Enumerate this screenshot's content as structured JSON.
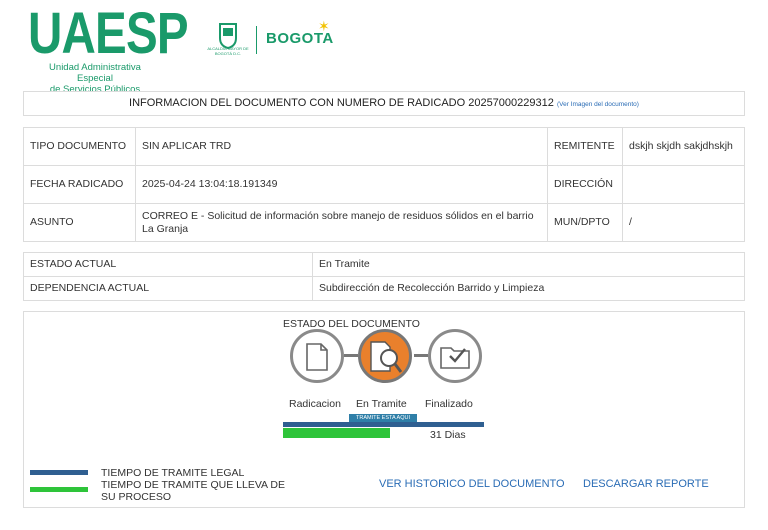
{
  "header": {
    "logo": "UAESP",
    "logo_sub_1": "Unidad Administrativa Especial",
    "logo_sub_2": "de Servicios Públicos",
    "alcaldia_text": "ALCALDÍA MAYOR DE BOGOTÁ D.C.",
    "bogota": "BOGOTA"
  },
  "title": {
    "text": "INFORMACION DEL DOCUMENTO CON NUMERO DE RADICADO 20257000229312",
    "link": "(Ver Imagen del documento)"
  },
  "info": {
    "tipo_label": "TIPO DOCUMENTO",
    "tipo_value": "SIN APLICAR TRD",
    "remitente_label": "REMITENTE",
    "remitente_value": "dskjh skjdh sakjdhskjh",
    "fecha_label": "FECHA RADICADO",
    "fecha_value": "2025-04-24 13:04:18.191349",
    "direccion_label": "DIRECCIÓN",
    "direccion_value": "",
    "asunto_label": "ASUNTO",
    "asunto_value": "CORREO E - Solicitud de información sobre manejo de residuos sólidos en el barrio La Granja",
    "mun_label": "MUN/DPTO",
    "mun_value": "/"
  },
  "estado": {
    "estado_label": "ESTADO ACTUAL",
    "estado_value": "En Tramite",
    "dependencia_label": "DEPENDENCIA ACTUAL",
    "dependencia_value": "Subdirección de Recolección Barrido y Limpieza"
  },
  "progress": {
    "heading": "ESTADO DEL DOCUMENTO",
    "stages": [
      "Radicacion",
      "En Tramite",
      "Finalizado"
    ],
    "tag": "TRAMITE ESTA AQUI",
    "days": "31 Dias",
    "legal_fraction": 1.0,
    "elapsed_fraction": 0.53,
    "legal_color": "#2f5f91",
    "elapsed_color": "#2ec43a",
    "active_color": "#e9802c"
  },
  "legend": {
    "legal": "TIEMPO DE TRAMITE LEGAL",
    "elapsed_1": "TIEMPO DE TRAMITE QUE LLEVA DE",
    "elapsed_2": "SU PROCESO"
  },
  "actions": {
    "historico": "VER HISTORICO DEL DOCUMENTO",
    "descargar": "DESCARGAR REPORTE"
  }
}
